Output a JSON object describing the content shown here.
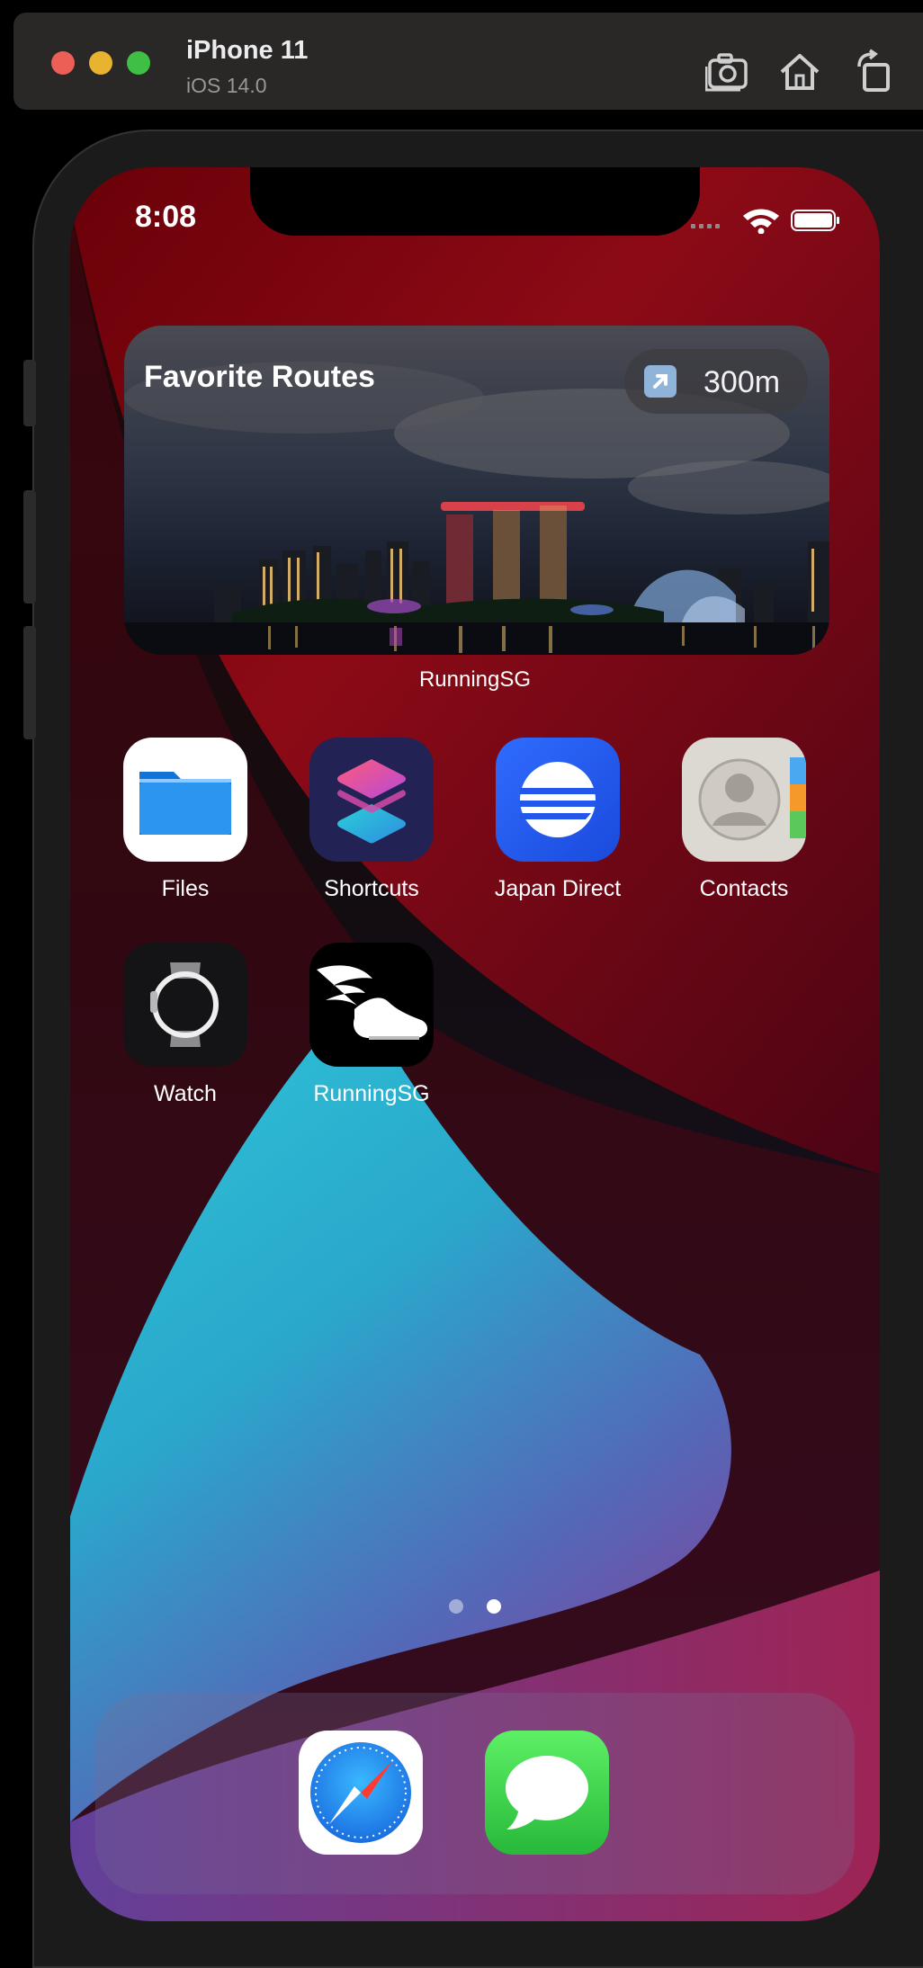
{
  "simulator": {
    "device_name": "iPhone 11",
    "os_version": "iOS 14.0",
    "window_buttons": [
      "close",
      "minimize",
      "zoom"
    ],
    "toolbar_icons": [
      "screenshot-icon",
      "home-icon",
      "rotate-icon"
    ]
  },
  "status_bar": {
    "time": "8:08"
  },
  "widget": {
    "title": "Favorite Routes",
    "distance": "300m",
    "caption": "RunningSG"
  },
  "apps": [
    {
      "label": "Files",
      "icon": "files-icon"
    },
    {
      "label": "Shortcuts",
      "icon": "shortcuts-icon"
    },
    {
      "label": "Japan Direct",
      "icon": "japan-direct-icon"
    },
    {
      "label": "Contacts",
      "icon": "contacts-icon"
    },
    {
      "label": "Watch",
      "icon": "watch-icon"
    },
    {
      "label": "RunningSG",
      "icon": "running-shoe-icon"
    }
  ],
  "page_indicator": {
    "pages": 2,
    "current": 2
  },
  "dock": [
    {
      "name": "Safari",
      "icon": "safari-icon"
    },
    {
      "name": "Messages",
      "icon": "messages-icon"
    }
  ],
  "colors": {
    "close": "#ec5f56",
    "minimize": "#e8b32f",
    "zoom": "#3fbf43",
    "files_blue": "#1e8ff0",
    "messages_green": "#3fcf4c"
  }
}
